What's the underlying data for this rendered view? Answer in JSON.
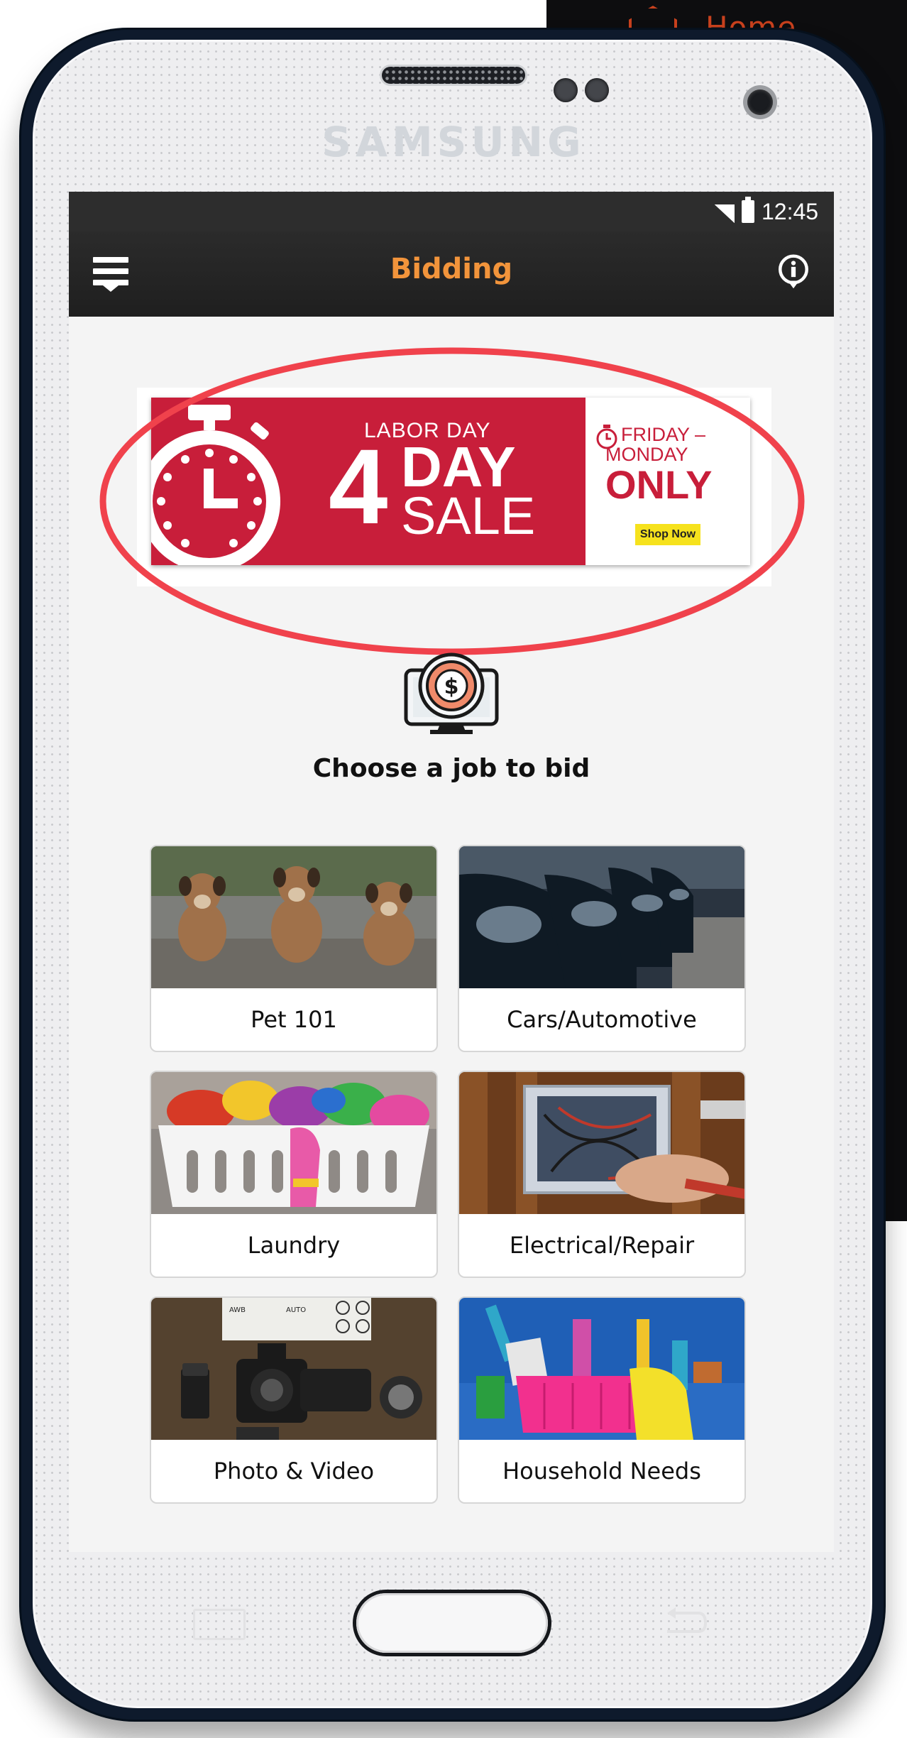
{
  "background": {
    "home_label": "Home",
    "home_color": "#c8411e"
  },
  "device": {
    "brand": "SAMSUNG"
  },
  "status_bar": {
    "time": "12:45",
    "icons": [
      "signal-icon",
      "battery-icon"
    ]
  },
  "app_bar": {
    "title": "Bidding",
    "title_color": "#f2943b",
    "left_icon": "hamburger-menu-icon",
    "right_icon": "info-icon"
  },
  "banner": {
    "headline_small": "LABOR DAY",
    "number": "4",
    "word_day": "DAY",
    "word_sale": "SALE",
    "friday": "FRIDAY –",
    "monday": "MONDAY",
    "only": "ONLY",
    "cta": "Shop Now",
    "brand_color": "#c81e3a",
    "highlight_color": "#f0424c"
  },
  "main": {
    "icon": "bid-monitor-dollar-icon",
    "title": "Choose a job to bid"
  },
  "categories": [
    {
      "label": "Pet 101",
      "icon": "pet-photo"
    },
    {
      "label": "Cars/Automotive",
      "icon": "cars-photo"
    },
    {
      "label": "Laundry",
      "icon": "laundry-photo"
    },
    {
      "label": "Electrical/Repair",
      "icon": "electrical-photo"
    },
    {
      "label": "Photo & Video",
      "icon": "camera-photo"
    },
    {
      "label": "Household Needs",
      "icon": "cleaning-supplies-photo"
    }
  ],
  "photo_text": {
    "camera_mode_awb": "AWB",
    "camera_mode_auto": "AUTO"
  }
}
